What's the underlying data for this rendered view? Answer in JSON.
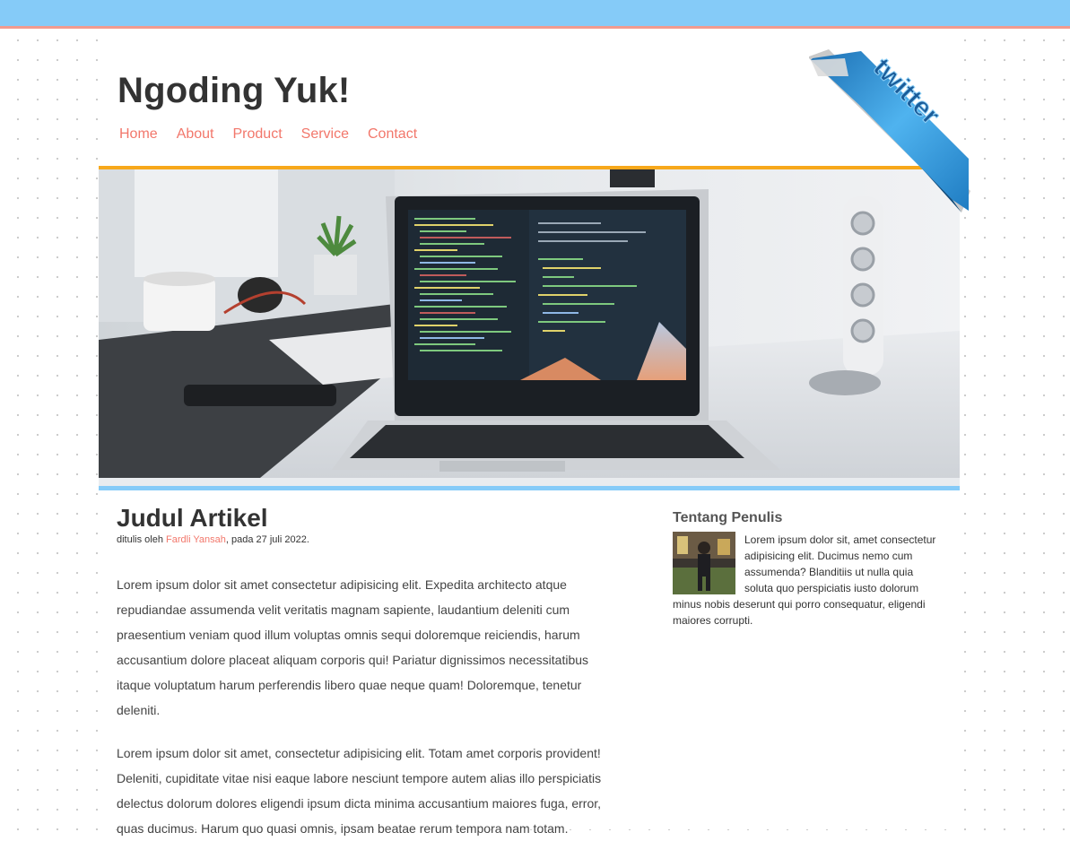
{
  "site": {
    "title": "Ngoding Yuk!"
  },
  "nav": {
    "items": [
      "Home",
      "About",
      "Product",
      "Service",
      "Contact"
    ]
  },
  "ribbon": {
    "label": "twitter"
  },
  "article": {
    "title": "Judul Artikel",
    "byline_prefix": "ditulis oleh ",
    "author": "Fardli Yansah",
    "byline_suffix": ", pada 27 juli 2022.",
    "paragraphs": [
      "Lorem ipsum dolor sit amet consectetur adipisicing elit. Expedita architecto atque repudiandae assumenda velit veritatis magnam sapiente, laudantium deleniti cum praesentium veniam quod illum voluptas omnis sequi doloremque reiciendis, harum accusantium dolore placeat aliquam corporis qui! Pariatur dignissimos necessitatibus itaque voluptatum harum perferendis libero quae neque quam! Doloremque, tenetur deleniti.",
      "Lorem ipsum dolor sit amet, consectetur adipisicing elit. Totam amet corporis provident! Deleniti, cupiditate vitae nisi eaque labore nesciunt tempore autem alias illo perspiciatis delectus dolorum dolores eligendi ipsum dicta minima accusantium maiores fuga, error, quas ducimus. Harum quo quasi omnis, ipsam beatae rerum tempora nam totam."
    ]
  },
  "sidebar": {
    "heading": "Tentang Penulis",
    "text": "Lorem ipsum dolor sit, amet consectetur adipisicing elit. Ducimus nemo cum assumenda? Blanditiis ut nulla quia soluta quo perspiciatis iusto dolorum minus nobis deserunt qui porro consequatur, eligendi maiores corrupti."
  },
  "colors": {
    "top_strip": "#85cbf8",
    "top_strip_border": "#f19b8f",
    "accent_link": "#f2776b",
    "hero_top_border": "#f7a81b",
    "hero_bottom_border": "#85cbf8",
    "ribbon_blue": "#2b8fd6"
  }
}
